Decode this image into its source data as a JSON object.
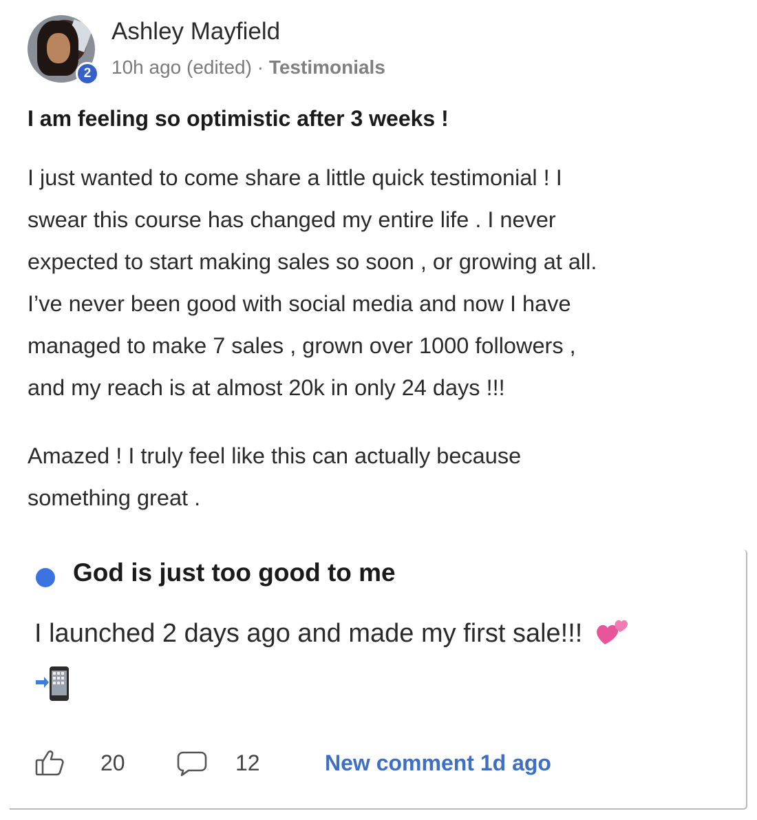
{
  "post": {
    "author": "Ashley Mayfield",
    "level": "2",
    "time": "10h ago (edited)",
    "separator": "·",
    "category": "Testimonials",
    "title": "I am feeling so optimistic after 3 weeks !",
    "body_lines": [
      "I just wanted to come share a little quick testimonial ! I",
      "swear this course has changed my entire life . I never",
      "expected to start making sales so soon , or growing at all.",
      "I’ve never been good with social media and now I have",
      "managed to make 7 sales , grown over 1000 followers ,",
      "and my reach is at almost 20k in only 24 days !!!"
    ],
    "body2_lines": [
      "Amazed ! I truly feel like this can actually because",
      "something great ."
    ]
  },
  "card2": {
    "title": "God is just too good to me",
    "body": "I launched 2 days ago and made my first sale!!!",
    "likes": "20",
    "comments": "12",
    "new_comment": "New comment 1d ago",
    "accent_color": "#3b74e0",
    "link_color": "#3e6fc2"
  },
  "icons": {
    "hearts": "two-hearts-icon",
    "phone": "phone-with-arrow-icon",
    "like": "thumbs-up-icon",
    "comment": "comment-bubble-icon"
  }
}
